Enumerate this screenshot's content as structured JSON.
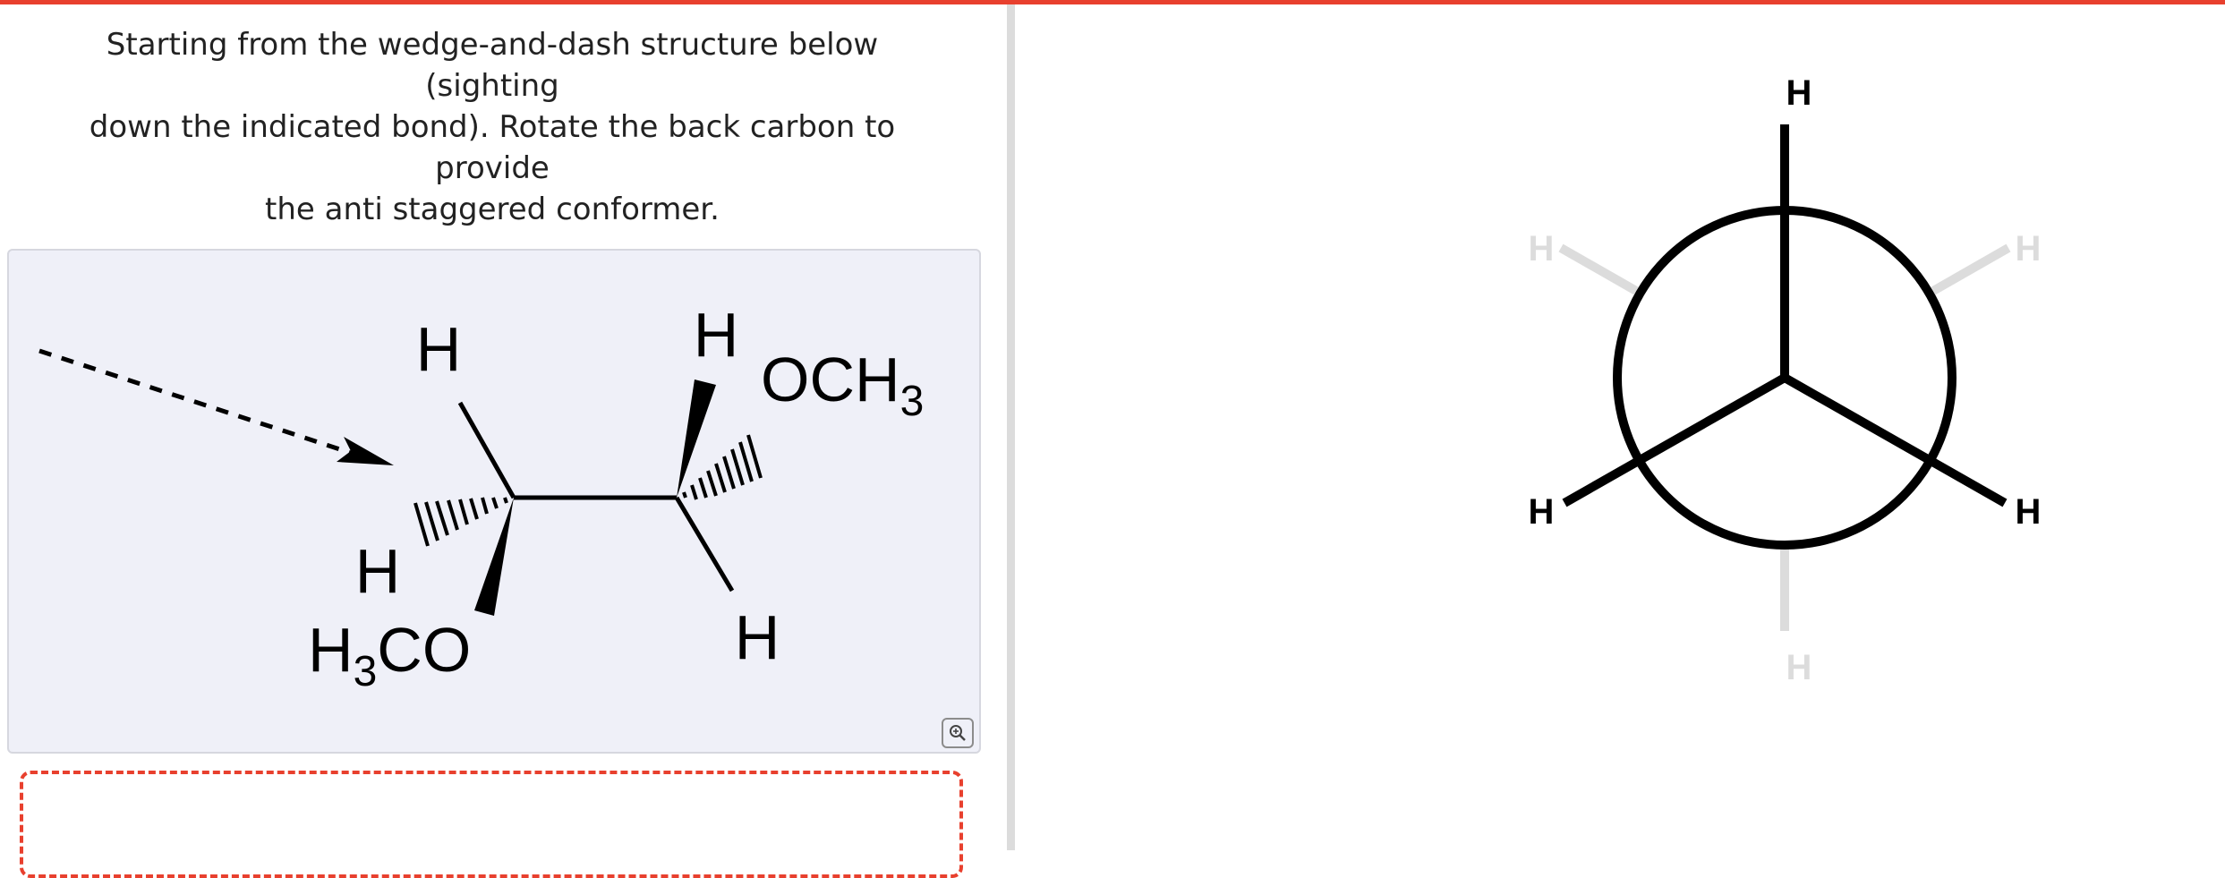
{
  "prompt": {
    "line1": "Starting from the wedge-and-dash structure below (sighting",
    "line2": "down the indicated bond). Rotate the back carbon to provide",
    "line3": "the anti staggered conformer."
  },
  "structure": {
    "top_h_left": "H",
    "top_h_right": "H",
    "och3_right": "OCH",
    "och3_right_sub": "3",
    "dash_h_left": "H",
    "h3co_h": "H",
    "h3co_sub": "3",
    "h3co_co": "CO",
    "bottom_h_right": "H"
  },
  "newman": {
    "front_top": "H",
    "front_left": "H",
    "front_right": "H",
    "back_top_left": "H",
    "back_top_right": "H",
    "back_bottom": "H"
  },
  "colors": {
    "accent": "#e8402e",
    "back_bonds": "#dcdcdc",
    "panel_bg": "#eff0f8"
  },
  "icons": {
    "zoom": "zoom-in-icon"
  }
}
